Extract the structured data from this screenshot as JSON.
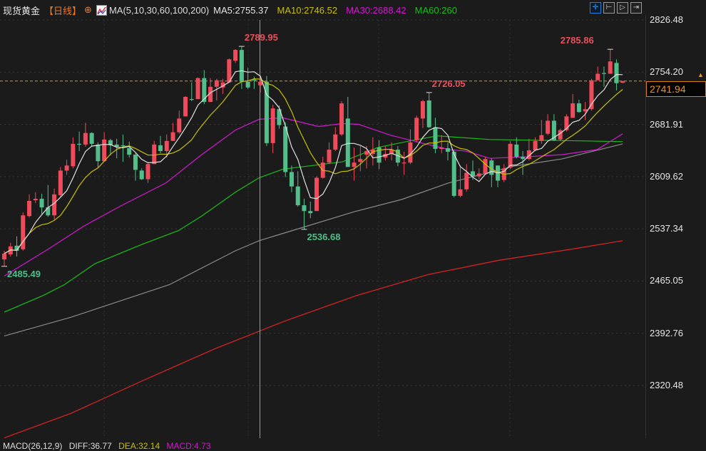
{
  "header": {
    "title": "现货黄金",
    "period": "【日线】",
    "add_icon": "⊕",
    "ma_label": "MA(5,10,30,60,100,200)",
    "ma5": "MA5:2755.37",
    "ma10": "MA10:2746.52",
    "ma30": "MA30:2688.42",
    "ma60": "MA60:260"
  },
  "toolbar": [
    {
      "icon": "crosshair-icon",
      "glyph": "✛"
    },
    {
      "icon": "range-start-icon",
      "glyph": "⊢"
    },
    {
      "icon": "play-icon",
      "glyph": "▷"
    },
    {
      "icon": "exit-icon",
      "glyph": "⇥"
    }
  ],
  "current_price": "2741.94",
  "macd": {
    "label": "MACD(26,12,9)",
    "diff": "DIFF:36.77",
    "dea": "DEA:32.14",
    "macd": "MACD:4.73"
  },
  "colors": {
    "up": "#f04b5b",
    "down": "#52bf8b",
    "ma5": "#e0e0e0",
    "ma10": "#c8c000",
    "ma30": "#d21ad2",
    "ma60": "#18c018",
    "ma100": "#8a8a8a",
    "ma200": "#e02424",
    "price_line": "#f09020"
  },
  "chart_data": {
    "type": "candlestick",
    "title": "现货黄金 日线",
    "y_ticks": [
      "2826.48",
      "2754.20",
      "2681.91",
      "2609.62",
      "2537.34",
      "2465.05",
      "2392.76",
      "2320.48"
    ],
    "ylim": [
      2245,
      2830
    ],
    "annotations": [
      {
        "text": "2789.95",
        "index": 39,
        "kind": "high"
      },
      {
        "text": "2536.68",
        "index": 49,
        "kind": "low"
      },
      {
        "text": "2726.05",
        "index": 69,
        "kind": "high"
      },
      {
        "text": "2785.86",
        "index": 98,
        "kind": "high"
      },
      {
        "text": "2485.49",
        "index": 1,
        "kind": "low"
      }
    ],
    "ohlc": [
      [
        2495,
        2507,
        2485.49,
        2503
      ],
      [
        2502,
        2518,
        2499,
        2513
      ],
      [
        2514,
        2527,
        2499,
        2507
      ],
      [
        2509,
        2560,
        2507,
        2556
      ],
      [
        2555,
        2585,
        2553,
        2576
      ],
      [
        2577,
        2588,
        2573,
        2579
      ],
      [
        2579,
        2586,
        2558,
        2567
      ],
      [
        2567,
        2598,
        2554,
        2556
      ],
      [
        2556,
        2593,
        2550,
        2585
      ],
      [
        2584,
        2623,
        2582,
        2618
      ],
      [
        2618,
        2633,
        2612,
        2625
      ],
      [
        2624,
        2664,
        2621,
        2655
      ],
      [
        2655,
        2672,
        2645,
        2654
      ],
      [
        2654,
        2684,
        2651,
        2670
      ],
      [
        2670,
        2671,
        2651,
        2655
      ],
      [
        2654,
        2657,
        2622,
        2631
      ],
      [
        2631,
        2671,
        2631,
        2661
      ],
      [
        2660,
        2662,
        2639,
        2653
      ],
      [
        2654,
        2662,
        2635,
        2651
      ],
      [
        2653,
        2668,
        2630,
        2652
      ],
      [
        2649,
        2658,
        2636,
        2640
      ],
      [
        2640,
        2642,
        2604,
        2619
      ],
      [
        2618,
        2621,
        2605,
        2606
      ],
      [
        2606,
        2629,
        2601,
        2627
      ],
      [
        2627,
        2659,
        2627,
        2654
      ],
      [
        2653,
        2666,
        2642,
        2645
      ],
      [
        2645,
        2668,
        2636,
        2659
      ],
      [
        2659,
        2684,
        2659,
        2671
      ],
      [
        2671,
        2701,
        2669,
        2690
      ],
      [
        2693,
        2721,
        2693,
        2720
      ],
      [
        2717,
        2740,
        2714,
        2716
      ],
      [
        2717,
        2747,
        2717,
        2746
      ],
      [
        2746,
        2757,
        2710,
        2713
      ],
      [
        2713,
        2746,
        2713,
        2734
      ],
      [
        2734,
        2745,
        2715,
        2743
      ],
      [
        2733,
        2745,
        2724,
        2740
      ],
      [
        2740,
        2773,
        2740,
        2772
      ],
      [
        2770,
        2786,
        2767,
        2785
      ],
      [
        2785,
        2789.95,
        2731,
        2741
      ],
      [
        2741,
        2760,
        2731,
        2733
      ],
      [
        2744,
        2748,
        2731,
        2743
      ],
      [
        2736,
        2748,
        2726,
        2741
      ],
      [
        2741,
        2749,
        2652,
        2656
      ],
      [
        2656,
        2709,
        2642,
        2704
      ],
      [
        2703,
        2708,
        2676,
        2681
      ],
      [
        2679,
        2685,
        2609,
        2616
      ],
      [
        2616,
        2625,
        2588,
        2596
      ],
      [
        2596,
        2617,
        2568,
        2570
      ],
      [
        2570,
        2579,
        2536.68,
        2562
      ],
      [
        2562,
        2575,
        2552,
        2559
      ],
      [
        2562,
        2610,
        2562,
        2608
      ],
      [
        2608,
        2637,
        2607,
        2629
      ],
      [
        2629,
        2657,
        2627,
        2647
      ],
      [
        2647,
        2678,
        2645,
        2668
      ],
      [
        2668,
        2714,
        2666,
        2711
      ],
      [
        2690,
        2720,
        2623,
        2623
      ],
      [
        2623,
        2650,
        2604,
        2629
      ],
      [
        2630,
        2652,
        2617,
        2634
      ],
      [
        2640,
        2652,
        2621,
        2645
      ],
      [
        2641,
        2664,
        2625,
        2647
      ],
      [
        2650,
        2660,
        2620,
        2629
      ],
      [
        2636,
        2652,
        2632,
        2641
      ],
      [
        2641,
        2657,
        2632,
        2647
      ],
      [
        2647,
        2652,
        2624,
        2629
      ],
      [
        2628,
        2644,
        2612,
        2629
      ],
      [
        2629,
        2675,
        2627,
        2657
      ],
      [
        2660,
        2694,
        2657,
        2691
      ],
      [
        2690,
        2716,
        2677,
        2714
      ],
      [
        2715,
        2726.05,
        2677,
        2678
      ],
      [
        2678,
        2691,
        2642,
        2648
      ],
      [
        2648,
        2667,
        2642,
        2650
      ],
      [
        2649,
        2657,
        2632,
        2644
      ],
      [
        2644,
        2647,
        2581,
        2583
      ],
      [
        2583,
        2625,
        2581,
        2592
      ],
      [
        2592,
        2627,
        2589,
        2615
      ],
      [
        2617,
        2632,
        2605,
        2610
      ],
      [
        2610,
        2621,
        2606,
        2614
      ],
      [
        2614,
        2637,
        2612,
        2634
      ],
      [
        2632,
        2635,
        2595,
        2612
      ],
      [
        2625,
        2625,
        2595,
        2604
      ],
      [
        2605,
        2627,
        2602,
        2621
      ],
      [
        2622,
        2659,
        2620,
        2655
      ],
      [
        2654,
        2664,
        2635,
        2637
      ],
      [
        2637,
        2645,
        2612,
        2634
      ],
      [
        2634,
        2662,
        2632,
        2646
      ],
      [
        2646,
        2664,
        2645,
        2659
      ],
      [
        2659,
        2688,
        2655,
        2667
      ],
      [
        2669,
        2696,
        2667,
        2687
      ],
      [
        2687,
        2696,
        2659,
        2660
      ],
      [
        2661,
        2676,
        2659,
        2674
      ],
      [
        2674,
        2696,
        2672,
        2693
      ],
      [
        2691,
        2724,
        2691,
        2711
      ],
      [
        2711,
        2716,
        2698,
        2699
      ],
      [
        2700,
        2713,
        2688,
        2703
      ],
      [
        2703,
        2745,
        2701,
        2743
      ],
      [
        2743,
        2762,
        2743,
        2752
      ],
      [
        2753,
        2762,
        2734,
        2752
      ],
      [
        2752,
        2785.86,
        2752,
        2769
      ],
      [
        2767,
        2772,
        2729,
        2739
      ],
      [
        2739.5,
        2742,
        2739,
        2741.94
      ]
    ],
    "ma_series": {
      "ma30": [
        [
          1,
          2472
        ],
        [
          8,
          2509
        ],
        [
          13.7,
          2541
        ],
        [
          19.4,
          2568
        ],
        [
          26.9,
          2601
        ],
        [
          32.6,
          2640
        ],
        [
          38,
          2674
        ],
        [
          41.8,
          2689
        ],
        [
          45.6,
          2691
        ],
        [
          49.4,
          2683
        ],
        [
          51.3,
          2679
        ],
        [
          55.1,
          2683
        ],
        [
          57.7,
          2682
        ],
        [
          62.8,
          2667
        ],
        [
          66.5,
          2659
        ],
        [
          72.2,
          2647
        ],
        [
          74.9,
          2645
        ],
        [
          78.7,
          2635
        ],
        [
          84.4,
          2637
        ],
        [
          90.2,
          2640
        ],
        [
          95.9,
          2647
        ],
        [
          100,
          2669
        ]
      ],
      "ma60": [
        [
          1,
          2422
        ],
        [
          7.2,
          2445
        ],
        [
          10.6,
          2460
        ],
        [
          15.5,
          2489
        ],
        [
          23.1,
          2516
        ],
        [
          28.9,
          2535
        ],
        [
          32.6,
          2555
        ],
        [
          38,
          2588
        ],
        [
          41.8,
          2608
        ],
        [
          45.6,
          2620
        ],
        [
          49.4,
          2624
        ],
        [
          55.1,
          2630
        ],
        [
          60.8,
          2650
        ],
        [
          66.5,
          2660
        ],
        [
          70.3,
          2666
        ],
        [
          78.7,
          2661
        ],
        [
          86.3,
          2660
        ],
        [
          93.9,
          2659
        ],
        [
          100,
          2658
        ]
      ],
      "ma100": [
        [
          1,
          2389
        ],
        [
          11.7,
          2415
        ],
        [
          27.4,
          2460
        ],
        [
          38,
          2507
        ],
        [
          41.8,
          2521
        ],
        [
          49.4,
          2541
        ],
        [
          57,
          2561
        ],
        [
          64.6,
          2578
        ],
        [
          72.2,
          2601
        ],
        [
          82.5,
          2624
        ],
        [
          90.2,
          2634
        ],
        [
          100,
          2655
        ]
      ],
      "ma200": [
        [
          1,
          2248
        ],
        [
          11.7,
          2282
        ],
        [
          23.1,
          2327
        ],
        [
          34.6,
          2371
        ],
        [
          46,
          2410
        ],
        [
          57.4,
          2445
        ],
        [
          68.8,
          2474
        ],
        [
          80.3,
          2494
        ],
        [
          91.7,
          2509
        ],
        [
          100,
          2521
        ]
      ]
    }
  }
}
